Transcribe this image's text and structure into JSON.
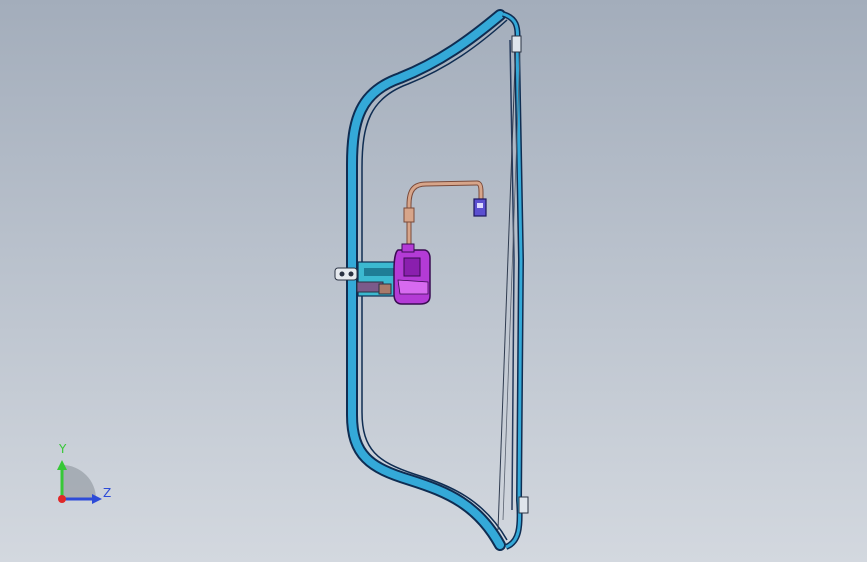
{
  "viewport": {
    "background_top": "#a3adbb",
    "background_bottom": "#d3d8df"
  },
  "model": {
    "frame_color": "#34a9d8",
    "frame_edge_color": "#0f2d52",
    "motor_color": "#b43bd6",
    "bracket_color": "#3cb9d0",
    "cable_color": "#d7a58a",
    "connector_color": "#5b4fd0",
    "icon": "window-regulator-assembly"
  },
  "triad": {
    "y_label": "Y",
    "z_label": "Z",
    "y_color": "#37c837",
    "z_color": "#2d4bd8",
    "origin_color": "#e02828"
  }
}
